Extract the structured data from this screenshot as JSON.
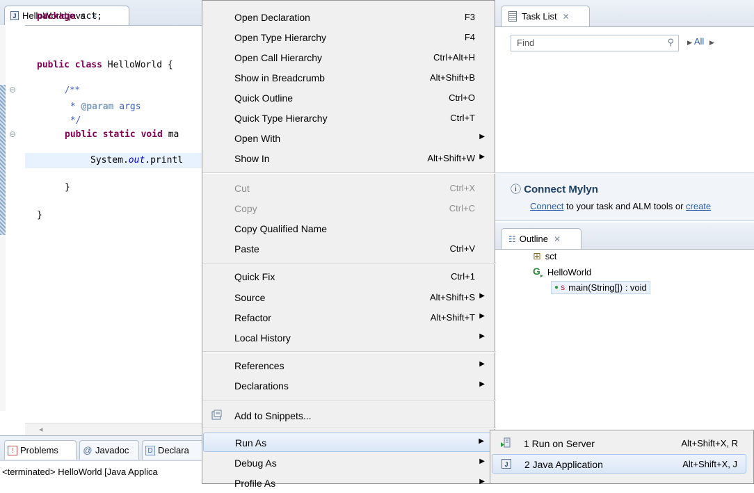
{
  "editor": {
    "tab_title": "HelloWorld.java",
    "code": {
      "l1_kw": "package",
      "l1_rest": " sct;",
      "l2_kw": "public class",
      "l2_rest": " HelloWorld {",
      "l3": "/**",
      "l4_star": " * ",
      "l4_tag": "@param",
      "l4_rest": " args",
      "l5": " */",
      "l6_kw": "public static void",
      "l6_rest": " ma",
      "l7_a": "System.",
      "l7_b": "out",
      "l7_c": ".printl",
      "l8": "}",
      "l9": "}"
    }
  },
  "bottom_views": {
    "tabs": [
      "Problems",
      "Javadoc",
      "Declara"
    ],
    "console_text": "<terminated> HelloWorld [Java Applica"
  },
  "task_list": {
    "tab_title": "Task List",
    "find_placeholder": "Find",
    "all_label": "All"
  },
  "mylyn": {
    "title": "Connect Mylyn",
    "link_connect": "Connect",
    "middle_text": " to your task and ALM tools or ",
    "link_create": "create"
  },
  "outline": {
    "tab_title": "Outline",
    "items": [
      "sct",
      "HelloWorld",
      "main(String[]) : void"
    ],
    "static_marker": "S"
  },
  "context_menu": {
    "items": [
      {
        "label": "Open Declaration",
        "shortcut": "F3"
      },
      {
        "label": "Open Type Hierarchy",
        "shortcut": "F4"
      },
      {
        "label": "Open Call Hierarchy",
        "shortcut": "Ctrl+Alt+H"
      },
      {
        "label": "Show in Breadcrumb",
        "shortcut": "Alt+Shift+B"
      },
      {
        "label": "Quick Outline",
        "shortcut": "Ctrl+O"
      },
      {
        "label": "Quick Type Hierarchy",
        "shortcut": "Ctrl+T"
      },
      {
        "label": "Open With",
        "shortcut": ""
      },
      {
        "label": "Show In",
        "shortcut": "Alt+Shift+W"
      },
      {
        "label": "Cut",
        "shortcut": "Ctrl+X"
      },
      {
        "label": "Copy",
        "shortcut": "Ctrl+C"
      },
      {
        "label": "Copy Qualified Name",
        "shortcut": ""
      },
      {
        "label": "Paste",
        "shortcut": "Ctrl+V"
      },
      {
        "label": "Quick Fix",
        "shortcut": "Ctrl+1"
      },
      {
        "label": "Source",
        "shortcut": "Alt+Shift+S"
      },
      {
        "label": "Refactor",
        "shortcut": "Alt+Shift+T"
      },
      {
        "label": "Local History",
        "shortcut": ""
      },
      {
        "label": "References",
        "shortcut": ""
      },
      {
        "label": "Declarations",
        "shortcut": ""
      },
      {
        "label": "Add to Snippets...",
        "shortcut": ""
      },
      {
        "label": "Run As",
        "shortcut": ""
      },
      {
        "label": "Debug As",
        "shortcut": ""
      },
      {
        "label": "Profile As",
        "shortcut": ""
      }
    ]
  },
  "run_as_submenu": {
    "items": [
      {
        "label": "1 Run on Server",
        "shortcut": "Alt+Shift+X, R"
      },
      {
        "label": "2 Java Application",
        "shortcut": "Alt+Shift+X, J"
      }
    ]
  }
}
